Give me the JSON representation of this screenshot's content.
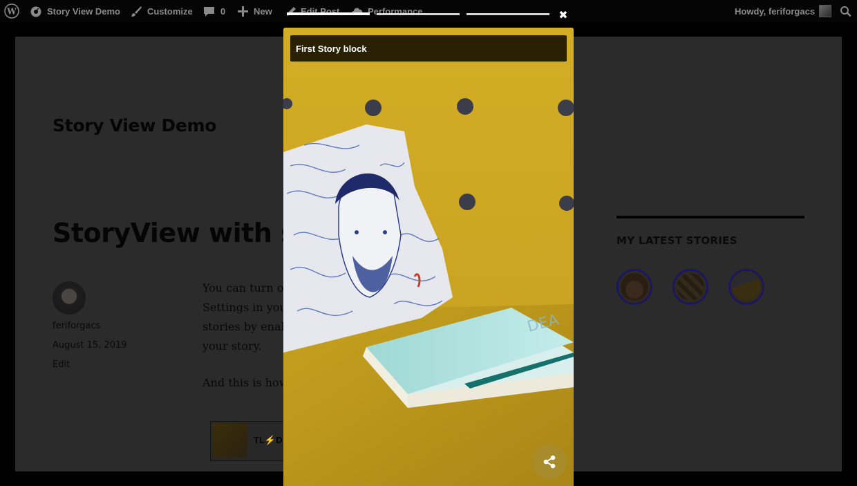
{
  "admin_bar": {
    "site_name": "Story View Demo",
    "customize": "Customize",
    "comments_count": "0",
    "new_label": "New",
    "edit_post": "Edit Post",
    "performance": "Performance",
    "greeting": "Howdy, feriforgacs"
  },
  "page": {
    "site_title": "Story View Demo",
    "post_title": "StoryView with s",
    "author": "feriforgacs",
    "date": "August 15, 2019",
    "edit": "Edit",
    "para_lines": [
      "You can turn o",
      "Settings in you",
      "stories by enab",
      "your story."
    ],
    "para2": "And this is how",
    "embed_text": "TL⚡D"
  },
  "sidebar": {
    "title": "MY LATEST STORIES",
    "stories": [
      "story-1",
      "story-2",
      "story-3"
    ]
  },
  "viewer": {
    "caption": "First Story block",
    "progress_total": 3,
    "progress_current": 1,
    "close_glyph": "✖"
  },
  "colors": {
    "backdrop": "#000000",
    "story_yellow": "#c9a623",
    "share_button": "#a88b2a",
    "story_ring": "#1a1760"
  }
}
